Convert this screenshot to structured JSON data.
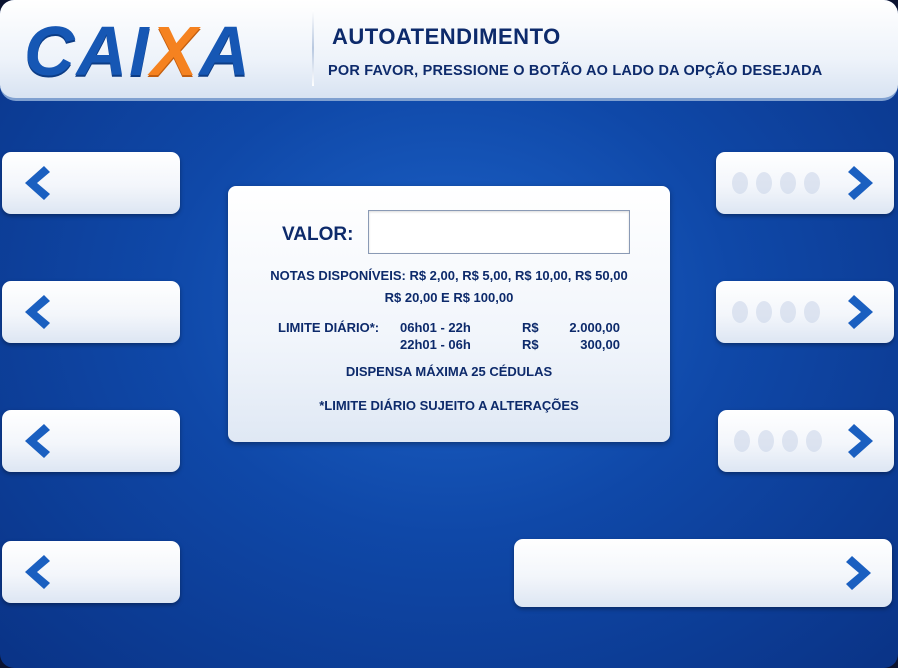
{
  "header": {
    "logo_text": "CAIXA",
    "title": "AUTOATENDIMENTO",
    "subtitle": "POR FAVOR, PRESSIONE O BOTÃO AO LADO DA OPÇÃO DESEJADA"
  },
  "panel": {
    "valor_label": "VALOR:",
    "valor_value": "",
    "notes_line1": "NOTAS DISPONÍVEIS: R$ 2,00, R$ 5,00, R$ 10,00, R$ 50,00",
    "notes_line2": "R$ 20,00 E R$ 100,00",
    "limit_label": "LIMITE DIÁRIO*:",
    "limits": [
      {
        "period": "06h01 - 22h",
        "currency": "R$",
        "amount": "2.000,00"
      },
      {
        "period": "22h01 - 06h",
        "currency": "R$",
        "amount": "300,00"
      }
    ],
    "max_notes": "DISPENSA MÁXIMA 25 CÉDULAS",
    "footnote": "*LIMITE DIÁRIO SUJEITO A ALTERAÇÕES"
  },
  "colors": {
    "brand_blue": "#1657b4",
    "brand_orange": "#f58220",
    "text_navy": "#0d2a6b",
    "chevron_blue": "#1a5fc0"
  },
  "icons": {
    "left_button": "chevron-left-icon",
    "right_button": "chevron-right-icon"
  }
}
